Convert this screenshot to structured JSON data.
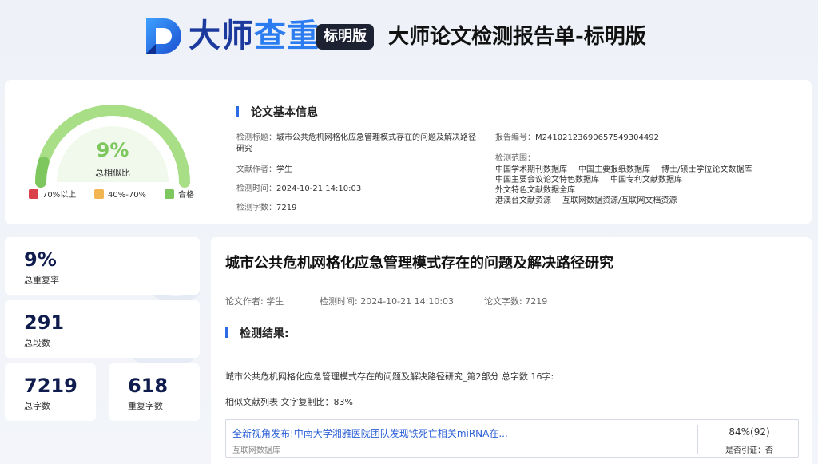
{
  "header": {
    "brand_part1": "大师",
    "brand_part2": "查重",
    "edition": "标明版",
    "report_title": "大师论文检测报告单-标明版"
  },
  "summary": {
    "similarity": "9%",
    "similarity_fraction": 0.09,
    "similarity_label": "总相似比",
    "legend": [
      {
        "label": "70%以上",
        "color": "#d9404a"
      },
      {
        "label": "40%-70%",
        "color": "#f3b552"
      },
      {
        "label": "合格",
        "color": "#7dc75e"
      }
    ]
  },
  "basic_info": {
    "section_title": "论文基本信息",
    "title_key": "检测标题：",
    "title_value_line1": "城市公共危机网格化应急管理模式存在的问题及解决路径",
    "title_value_line2": "研究",
    "author_key": "文献作者：",
    "author_value": "学生",
    "time_key": "检测时间：",
    "time_value": "2024-10-21 14:10:03",
    "words_key": "检测字数：",
    "words_value": "7219",
    "report_no_key": "报告编号：",
    "report_no_value": "M24102123690657549304492",
    "scope_key": "检测范围：",
    "scope_databases": [
      "中国学术期刊数据库",
      "中国主要报纸数据库",
      "博士/硕士学位论文数据库",
      "中国主要会议论文特色数据库",
      "中国专利文献数据库",
      "外文特色文献数据全库",
      "港澳台文献资源",
      "互联网数据资源/互联网文档资源"
    ]
  },
  "stats": [
    {
      "value": "9%",
      "label": "总重复率"
    },
    {
      "value": "291",
      "label": "总段数"
    },
    {
      "value": "7219",
      "label": "总字数"
    },
    {
      "value": "618",
      "label": "重复字数"
    }
  ],
  "main": {
    "paper_title": "城市公共危机网格化应急管理模式存在的问题及解决路径研究",
    "meta_author": "论文作者: 学生",
    "meta_time": "检测时间: 2024-10-21 14:10:03",
    "meta_words": "论文字数: 7219",
    "result_title": "检测结果:",
    "part_line": "城市公共危机网格化应急管理模式存在的问题及解决路径研究_第2部分 总字数 16字:",
    "similar_line": "相似文献列表 文字复制比：83%",
    "results": [
      {
        "link": "全新视角发布!中南大学湘雅医院团队发现铁死亡相关miRNA在...",
        "source": "互联网数据库",
        "percent": "84%(92)",
        "cited": "是否引证：否"
      }
    ]
  }
}
